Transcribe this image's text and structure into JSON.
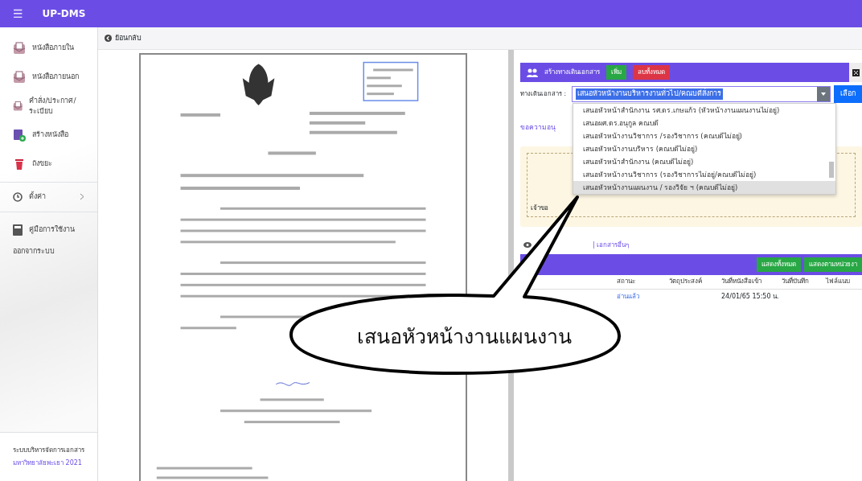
{
  "navbar": {
    "menu_glyph": "☰",
    "brand": "UP-DMS"
  },
  "sidebar": {
    "items": [
      {
        "label": "หนังสือภายใน",
        "kind": "mail",
        "selected": false
      },
      {
        "label": "หนังสือภายนอก",
        "kind": "mail",
        "selected": false
      },
      {
        "label": "คำสั่ง/ประกาศ/ระเบียบ",
        "kind": "mail",
        "selected": false
      },
      {
        "label": "สร้างหนังสือ",
        "kind": "create",
        "selected": false
      },
      {
        "label": "ถังขยะ",
        "kind": "trash",
        "selected": false
      }
    ],
    "settings": {
      "label": "ตั้งค่า",
      "expanded": false
    },
    "manual": {
      "label": "คู่มือการใช้งาน"
    },
    "logout": {
      "label": "ออกจากระบบ"
    },
    "footer": [
      "ระบบบริหารจัดการเอกสาร",
      "มหาวิทยาลัยพะเยา 2021"
    ]
  },
  "back_link": "ย้อนกลับ",
  "route_panel": {
    "title": "สร้างทางเดินเอกสาร",
    "add_button": "เพิ่ม",
    "delete_all_button": "ลบทั้งหมด",
    "field_label": "ทางเดินเอกสาร :",
    "value": "เสนอหัวหน้างานบริหารงานทั่วไป/คณบดีสั่งการ",
    "choose_button": "เลือก",
    "options": [
      {
        "label": "เสนอหัวหน้าสำนักงาน รศ.ดร.เกษแก้ว (หัวหน้างานแผนงานไม่อยู่)",
        "selected": false
      },
      {
        "label": "เสนอผศ.ดร.อนุกูล คณบดี",
        "selected": false
      },
      {
        "label": "เสนอหัวหน้างานวิชาการ /รองวิชาการ (คณบดีไม่อยู่)",
        "selected": false
      },
      {
        "label": "เสนอหัวหน้างานบริหาร (คณบดีไม่อยู่)",
        "selected": false
      },
      {
        "label": "เสนอหัวหน้าสำนักงาน (คณบดีไม่อยู่)",
        "selected": false
      },
      {
        "label": "เสนอหัวหน้างานวิชาการ (รองวิชาการไม่อยู่/คณบดีไม่อยู่)",
        "selected": false
      },
      {
        "label": "เสนอหัวหน้างานแผนงาน / รองวิจัย ฯ (คณบดีไม่อยู่)",
        "selected": true
      }
    ],
    "subject_heading": "ขอความอนุ",
    "owner_label": "เจ้าขอ"
  },
  "history": {
    "link": "| เอกสารอื่นๆ",
    "buttons": [
      "แสดงทั้งหมด",
      "แสดงตามหน่วยงา"
    ],
    "columns": [
      "สถานะ",
      "วัตถุประสงค์",
      "วันที่หนังสือเข้า",
      "วันที่บันทึก",
      "ไฟล์แนบ"
    ],
    "rows": [
      [
        "อ่านแล้ว",
        "",
        "24/01/65 15:50 น.",
        "",
        ""
      ]
    ]
  },
  "callout": "เสนอหัวหน้างานแผนงาน"
}
